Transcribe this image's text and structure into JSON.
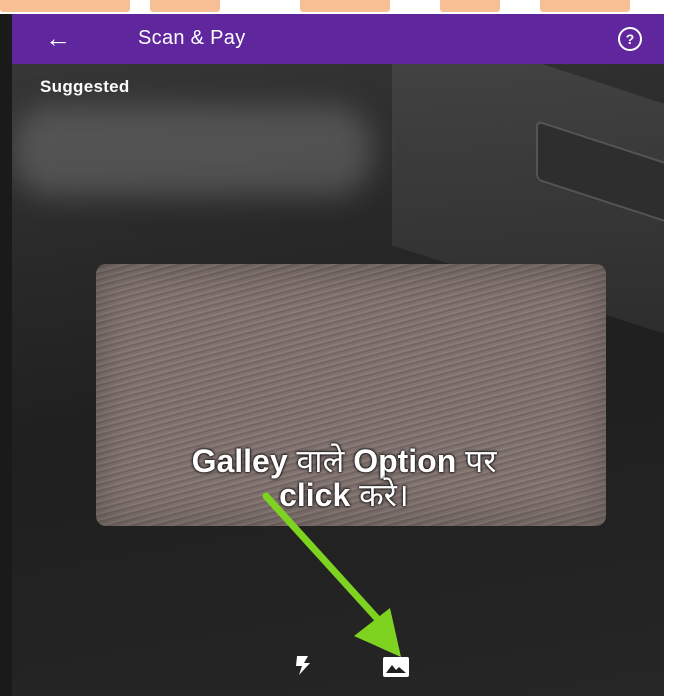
{
  "header": {
    "back_icon": "arrow-left-icon",
    "title": "Scan & Pay",
    "help_icon": "help-circle-icon",
    "help_glyph": "?",
    "background_color": "#5f269e"
  },
  "scanner": {
    "suggested_label": "Suggested",
    "flash_icon": "flash-icon",
    "gallery_icon": "gallery-icon"
  },
  "annotation": {
    "line1_part1": "Galley",
    "line1_part2": "वाले",
    "line1_part3": "Option",
    "line1_part4": "पर",
    "line2_part1": "click",
    "line2_part2": "करे।",
    "arrow_color": "#7ed321"
  }
}
